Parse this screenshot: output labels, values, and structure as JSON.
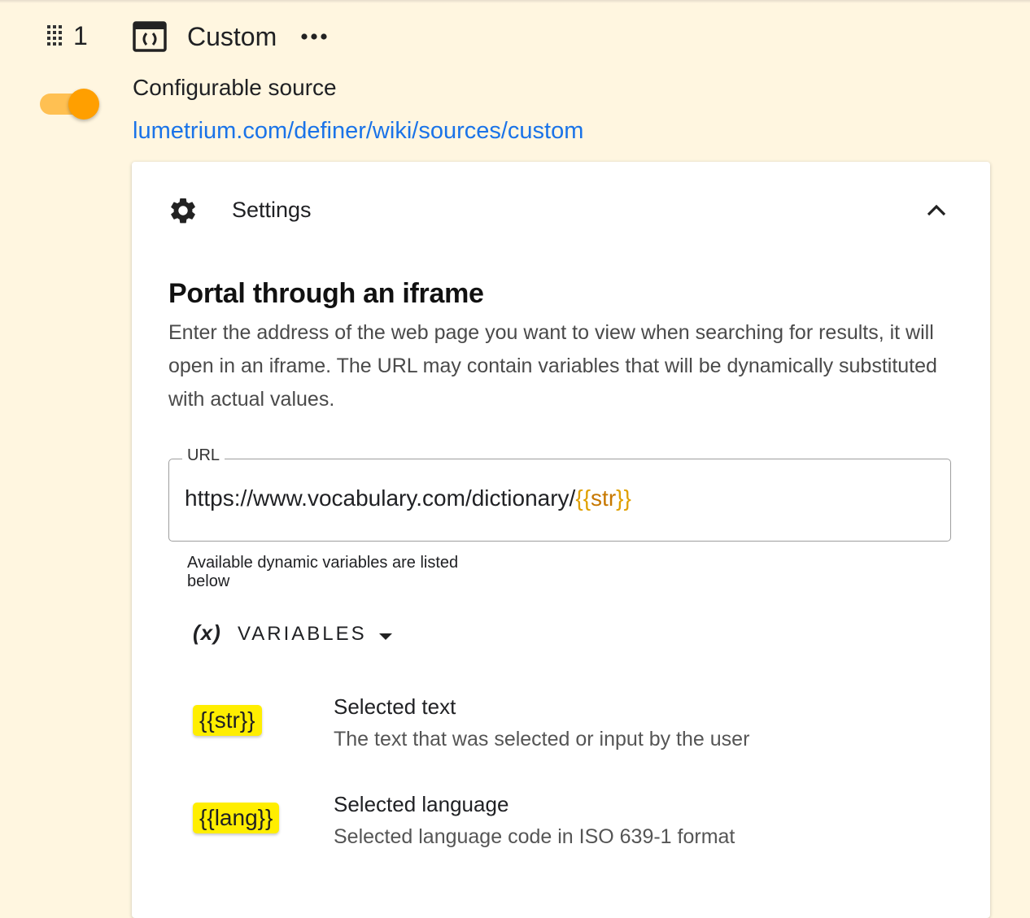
{
  "header": {
    "index": "1",
    "source_name": "Custom",
    "subtitle": "Configurable source",
    "link_text": "lumetrium.com/definer/wiki/sources/custom",
    "enabled": true,
    "icons": {
      "drag": "drag-handle-icon",
      "source": "iframe-source-icon",
      "more": "more-horizontal-icon"
    }
  },
  "colors": {
    "background": "#fff6e0",
    "accent": "#ff9f00",
    "toggle_track": "#ffc052",
    "link": "#1a73e8",
    "variable_chip": "#ffee00",
    "variable_text": "#c77800"
  },
  "settings": {
    "panel_title": "Settings",
    "expanded": true,
    "section_title": "Portal through an iframe",
    "section_description": "Enter the address of the web page you want to view when searching for results, it will open in an iframe. The URL may contain variables that will be dynamically substituted with actual values.",
    "url_field": {
      "label": "URL",
      "value_prefix": "https://www.vocabulary.com/dictionary/",
      "value_open": "{{",
      "value_variable": "str",
      "value_close": "}}"
    },
    "helper_text": "Available dynamic variables are listed below",
    "variables_toggle": {
      "symbol": "(x)",
      "label": "VARIABLES"
    },
    "variables": [
      {
        "token": "{{str}}",
        "name": "Selected text",
        "description": "The text that was selected or input by the user"
      },
      {
        "token": "{{lang}}",
        "name": "Selected language",
        "description": "Selected language code in ISO 639-1 format"
      }
    ]
  }
}
